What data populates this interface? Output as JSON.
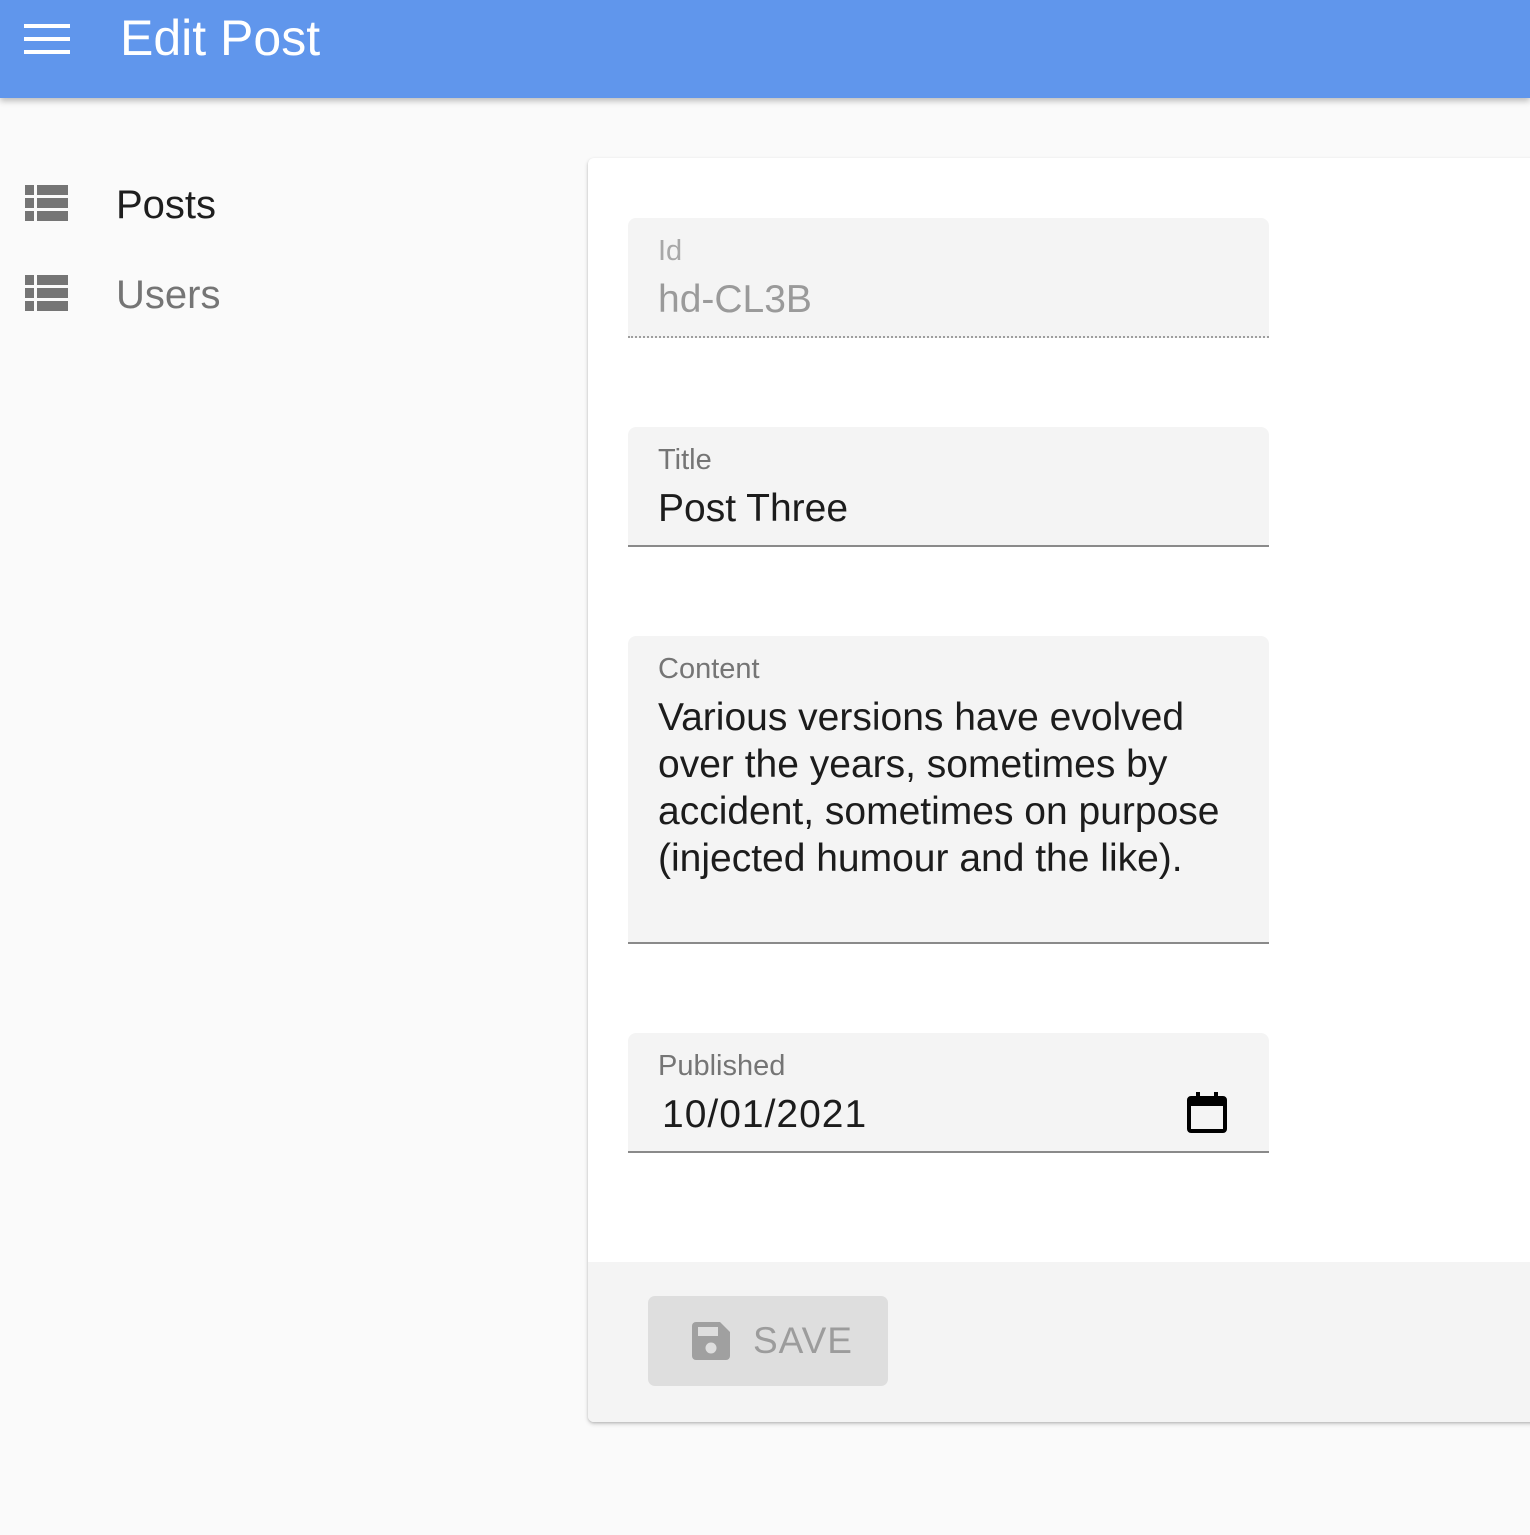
{
  "header": {
    "title": "Edit Post",
    "background_color": "#6096ec",
    "menu_icon": "hamburger-menu-icon"
  },
  "sidebar": {
    "items": [
      {
        "label": "Posts",
        "icon": "view-list-icon",
        "active": true
      },
      {
        "label": "Users",
        "icon": "view-list-icon",
        "active": false
      }
    ]
  },
  "form": {
    "fields": [
      {
        "label": "Id",
        "value": "hd-CL3B",
        "disabled": true
      },
      {
        "label": "Title",
        "value": "Post Three",
        "disabled": false
      },
      {
        "label": "Content",
        "value": "Various versions have evolved over the years, sometimes by accident, sometimes on purpose (injected humour and the like).",
        "disabled": false
      },
      {
        "label": "Published",
        "value": "10/01/2021",
        "disabled": false,
        "icon": "calendar-icon"
      }
    ]
  },
  "toolbar": {
    "save_label": "SAVE",
    "save_icon": "floppy-disk-icon",
    "save_disabled": true
  }
}
